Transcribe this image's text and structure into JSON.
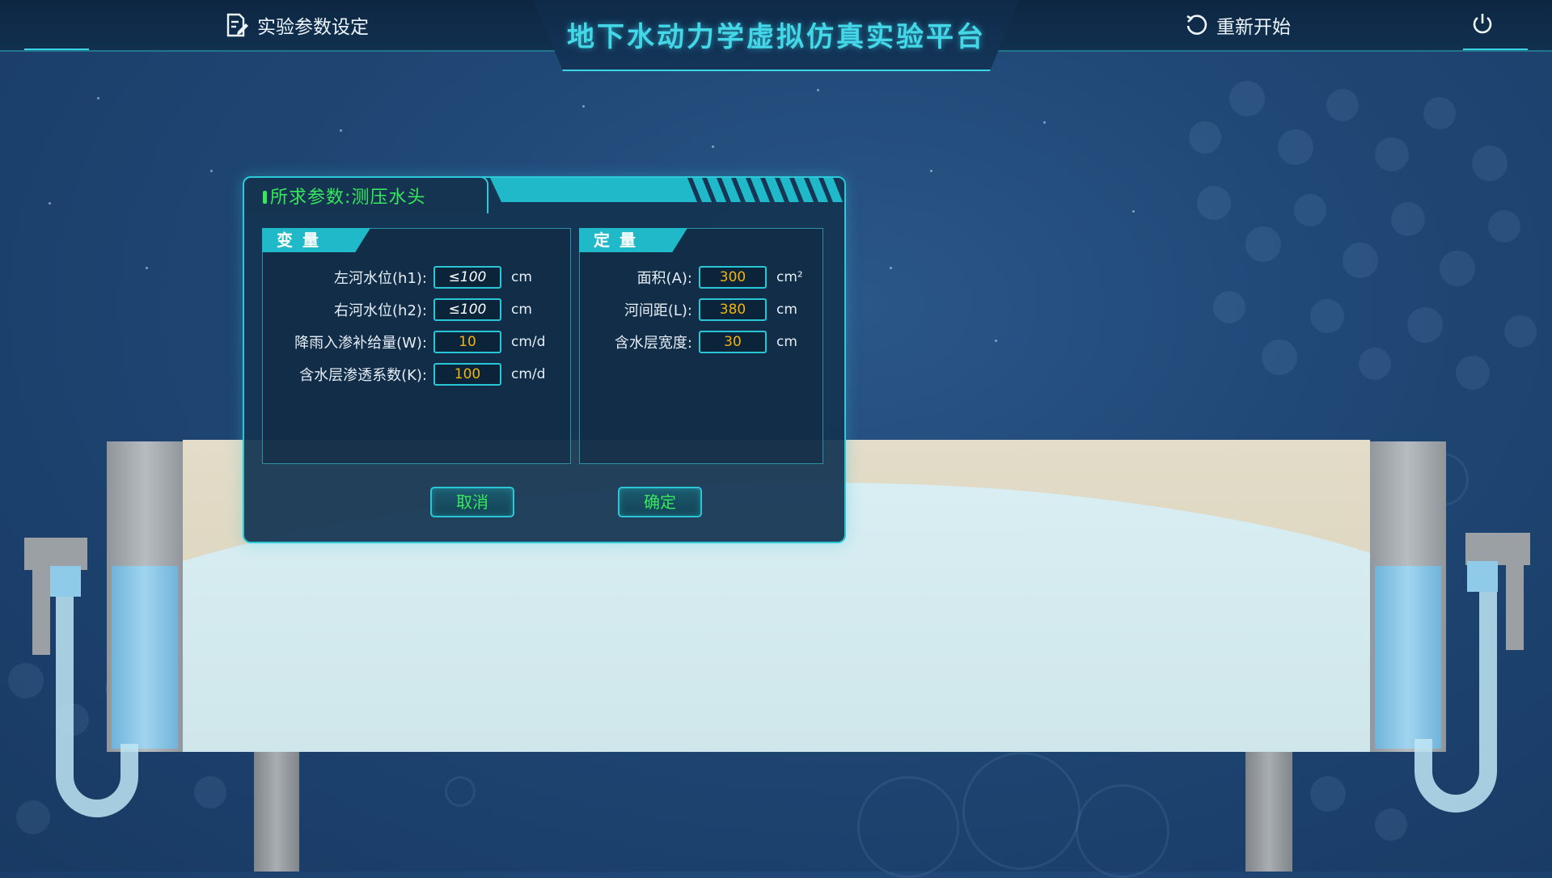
{
  "app": {
    "title": "地下水动力学虚拟仿真实验平台"
  },
  "topbar": {
    "settings_label": "实验参数设定",
    "settings_icon": "edit-document-icon",
    "restart_label": "重新开始",
    "restart_icon": "refresh-icon",
    "power_icon": "power-icon"
  },
  "dialog": {
    "title_prefix": "所求参数",
    "title_sep": ":",
    "title_value": "测压水头",
    "variables": {
      "label": "变量",
      "rows": [
        {
          "label": "左河水位(h1):",
          "value": "≤100",
          "unit": "cm"
        },
        {
          "label": "右河水位(h2):",
          "value": "≤100",
          "unit": "cm"
        },
        {
          "label": "降雨入渗补给量(W):",
          "value": "10",
          "unit": "cm/d"
        },
        {
          "label": "含水层渗透系数(K):",
          "value": "100",
          "unit": "cm/d"
        }
      ]
    },
    "constants": {
      "label": "定量",
      "rows": [
        {
          "label": "面积(A):",
          "value": "300",
          "unit": "cm²"
        },
        {
          "label": "河间距(L):",
          "value": "380",
          "unit": "cm"
        },
        {
          "label": "含水层宽度:",
          "value": "30",
          "unit": "cm"
        }
      ]
    },
    "cancel_label": "取消",
    "confirm_label": "确定"
  },
  "colors": {
    "accent": "#2ec9d8",
    "title": "#43d7e8",
    "highlight_green": "#37e85c",
    "input_value": "#f1b40f",
    "background": "#1f4674"
  }
}
